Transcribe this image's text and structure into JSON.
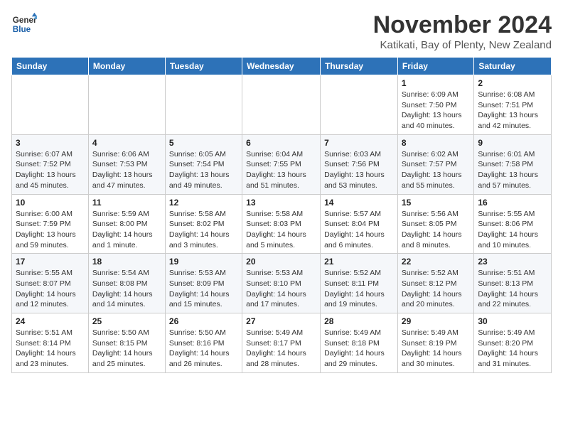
{
  "header": {
    "logo_line1": "General",
    "logo_line2": "Blue",
    "month": "November 2024",
    "location": "Katikati, Bay of Plenty, New Zealand"
  },
  "weekdays": [
    "Sunday",
    "Monday",
    "Tuesday",
    "Wednesday",
    "Thursday",
    "Friday",
    "Saturday"
  ],
  "weeks": [
    [
      {
        "day": "",
        "detail": ""
      },
      {
        "day": "",
        "detail": ""
      },
      {
        "day": "",
        "detail": ""
      },
      {
        "day": "",
        "detail": ""
      },
      {
        "day": "",
        "detail": ""
      },
      {
        "day": "1",
        "detail": "Sunrise: 6:09 AM\nSunset: 7:50 PM\nDaylight: 13 hours\nand 40 minutes."
      },
      {
        "day": "2",
        "detail": "Sunrise: 6:08 AM\nSunset: 7:51 PM\nDaylight: 13 hours\nand 42 minutes."
      }
    ],
    [
      {
        "day": "3",
        "detail": "Sunrise: 6:07 AM\nSunset: 7:52 PM\nDaylight: 13 hours\nand 45 minutes."
      },
      {
        "day": "4",
        "detail": "Sunrise: 6:06 AM\nSunset: 7:53 PM\nDaylight: 13 hours\nand 47 minutes."
      },
      {
        "day": "5",
        "detail": "Sunrise: 6:05 AM\nSunset: 7:54 PM\nDaylight: 13 hours\nand 49 minutes."
      },
      {
        "day": "6",
        "detail": "Sunrise: 6:04 AM\nSunset: 7:55 PM\nDaylight: 13 hours\nand 51 minutes."
      },
      {
        "day": "7",
        "detail": "Sunrise: 6:03 AM\nSunset: 7:56 PM\nDaylight: 13 hours\nand 53 minutes."
      },
      {
        "day": "8",
        "detail": "Sunrise: 6:02 AM\nSunset: 7:57 PM\nDaylight: 13 hours\nand 55 minutes."
      },
      {
        "day": "9",
        "detail": "Sunrise: 6:01 AM\nSunset: 7:58 PM\nDaylight: 13 hours\nand 57 minutes."
      }
    ],
    [
      {
        "day": "10",
        "detail": "Sunrise: 6:00 AM\nSunset: 7:59 PM\nDaylight: 13 hours\nand 59 minutes."
      },
      {
        "day": "11",
        "detail": "Sunrise: 5:59 AM\nSunset: 8:00 PM\nDaylight: 14 hours\nand 1 minute."
      },
      {
        "day": "12",
        "detail": "Sunrise: 5:58 AM\nSunset: 8:02 PM\nDaylight: 14 hours\nand 3 minutes."
      },
      {
        "day": "13",
        "detail": "Sunrise: 5:58 AM\nSunset: 8:03 PM\nDaylight: 14 hours\nand 5 minutes."
      },
      {
        "day": "14",
        "detail": "Sunrise: 5:57 AM\nSunset: 8:04 PM\nDaylight: 14 hours\nand 6 minutes."
      },
      {
        "day": "15",
        "detail": "Sunrise: 5:56 AM\nSunset: 8:05 PM\nDaylight: 14 hours\nand 8 minutes."
      },
      {
        "day": "16",
        "detail": "Sunrise: 5:55 AM\nSunset: 8:06 PM\nDaylight: 14 hours\nand 10 minutes."
      }
    ],
    [
      {
        "day": "17",
        "detail": "Sunrise: 5:55 AM\nSunset: 8:07 PM\nDaylight: 14 hours\nand 12 minutes."
      },
      {
        "day": "18",
        "detail": "Sunrise: 5:54 AM\nSunset: 8:08 PM\nDaylight: 14 hours\nand 14 minutes."
      },
      {
        "day": "19",
        "detail": "Sunrise: 5:53 AM\nSunset: 8:09 PM\nDaylight: 14 hours\nand 15 minutes."
      },
      {
        "day": "20",
        "detail": "Sunrise: 5:53 AM\nSunset: 8:10 PM\nDaylight: 14 hours\nand 17 minutes."
      },
      {
        "day": "21",
        "detail": "Sunrise: 5:52 AM\nSunset: 8:11 PM\nDaylight: 14 hours\nand 19 minutes."
      },
      {
        "day": "22",
        "detail": "Sunrise: 5:52 AM\nSunset: 8:12 PM\nDaylight: 14 hours\nand 20 minutes."
      },
      {
        "day": "23",
        "detail": "Sunrise: 5:51 AM\nSunset: 8:13 PM\nDaylight: 14 hours\nand 22 minutes."
      }
    ],
    [
      {
        "day": "24",
        "detail": "Sunrise: 5:51 AM\nSunset: 8:14 PM\nDaylight: 14 hours\nand 23 minutes."
      },
      {
        "day": "25",
        "detail": "Sunrise: 5:50 AM\nSunset: 8:15 PM\nDaylight: 14 hours\nand 25 minutes."
      },
      {
        "day": "26",
        "detail": "Sunrise: 5:50 AM\nSunset: 8:16 PM\nDaylight: 14 hours\nand 26 minutes."
      },
      {
        "day": "27",
        "detail": "Sunrise: 5:49 AM\nSunset: 8:17 PM\nDaylight: 14 hours\nand 28 minutes."
      },
      {
        "day": "28",
        "detail": "Sunrise: 5:49 AM\nSunset: 8:18 PM\nDaylight: 14 hours\nand 29 minutes."
      },
      {
        "day": "29",
        "detail": "Sunrise: 5:49 AM\nSunset: 8:19 PM\nDaylight: 14 hours\nand 30 minutes."
      },
      {
        "day": "30",
        "detail": "Sunrise: 5:49 AM\nSunset: 8:20 PM\nDaylight: 14 hours\nand 31 minutes."
      }
    ]
  ]
}
